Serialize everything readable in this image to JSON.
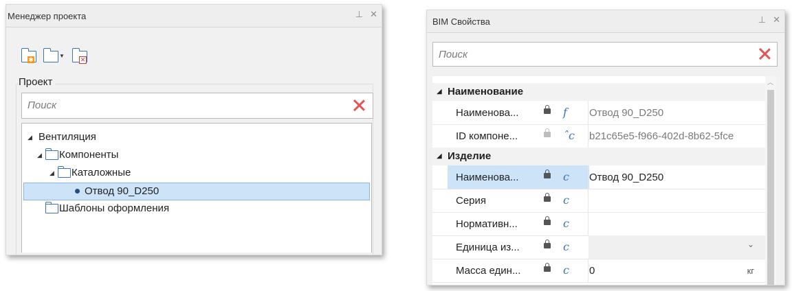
{
  "project_manager": {
    "title": "Менеджер проекта",
    "pin": "⊥",
    "close": "✕",
    "group_label": "Проект",
    "search_placeholder": "Поиск",
    "tree": {
      "root": "Вентиляция",
      "components": "Компоненты",
      "catalog": "Каталожные",
      "item": "Отвод 90_D250",
      "templates": "Шаблоны оформления"
    }
  },
  "bim": {
    "title": "BIM Свойства",
    "pin": "⊥",
    "close": "✕",
    "search_placeholder": "Поиск",
    "categories": [
      {
        "label": "Наименование",
        "rows": [
          {
            "name": "Наименова...",
            "kind": "f",
            "value": "Отвод 90_D250"
          },
          {
            "name": "ID компоне...",
            "kind": "ˆc",
            "value": "b21c65e5-f966-402d-8b62-5fce"
          }
        ]
      },
      {
        "label": "Изделие",
        "rows": [
          {
            "name": "Наименова...",
            "kind": "c",
            "value": "Отвод 90_D250"
          },
          {
            "name": "Серия",
            "kind": "c",
            "value": ""
          },
          {
            "name": "Нормативн...",
            "kind": "c",
            "value": ""
          },
          {
            "name": "Единица из...",
            "kind": "c",
            "value": ""
          },
          {
            "name": "Масса един...",
            "kind": "c",
            "value": "0",
            "unit": "кг"
          }
        ]
      }
    ]
  }
}
